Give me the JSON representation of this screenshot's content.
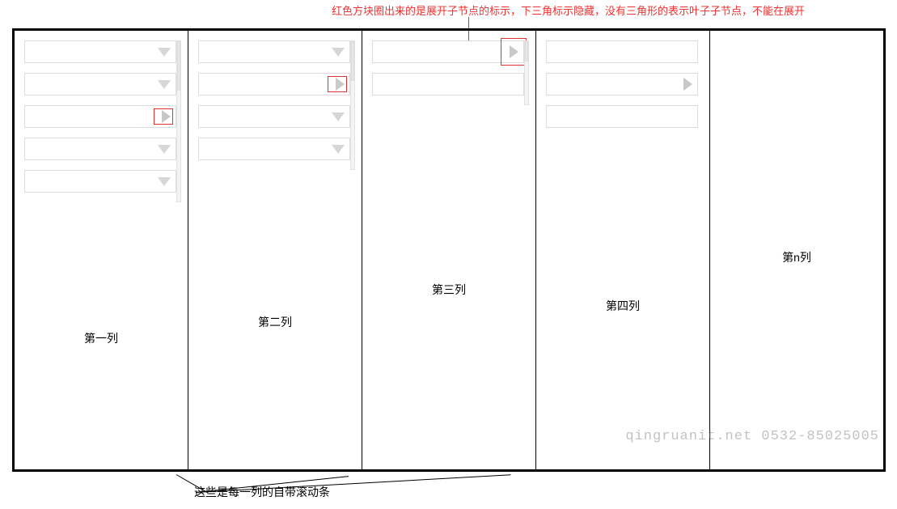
{
  "annotations": {
    "top": "红色方块圈出来的是展开子节点的标示，下三角标示隐藏，没有三角形的表示叶子子节点，不能在展开",
    "bottom": "这些是每一列的自带滚动条"
  },
  "columns": [
    {
      "label": "第一列",
      "has_scroll": true,
      "nodes": [
        {
          "icon": "down",
          "highlight": false
        },
        {
          "icon": "down",
          "highlight": false
        },
        {
          "icon": "right",
          "highlight": true
        },
        {
          "icon": "down",
          "highlight": false
        },
        {
          "icon": "down",
          "highlight": false
        }
      ]
    },
    {
      "label": "第二列",
      "has_scroll": true,
      "nodes": [
        {
          "icon": "down",
          "highlight": false
        },
        {
          "icon": "right",
          "highlight": true
        },
        {
          "icon": "down",
          "highlight": false
        },
        {
          "icon": "down",
          "highlight": false
        }
      ]
    },
    {
      "label": "第三列",
      "has_scroll": true,
      "nodes": [
        {
          "icon": "right",
          "highlight": true,
          "big_highlight": true
        },
        {
          "icon": "none",
          "highlight": false
        }
      ]
    },
    {
      "label": "第四列",
      "has_scroll": false,
      "nodes": [
        {
          "icon": "none",
          "highlight": false
        },
        {
          "icon": "right",
          "highlight": false
        },
        {
          "icon": "none",
          "highlight": false
        }
      ]
    },
    {
      "label": "第n列",
      "has_scroll": false,
      "nodes": []
    }
  ],
  "watermark": "qingruanit.net 0532-85025005"
}
